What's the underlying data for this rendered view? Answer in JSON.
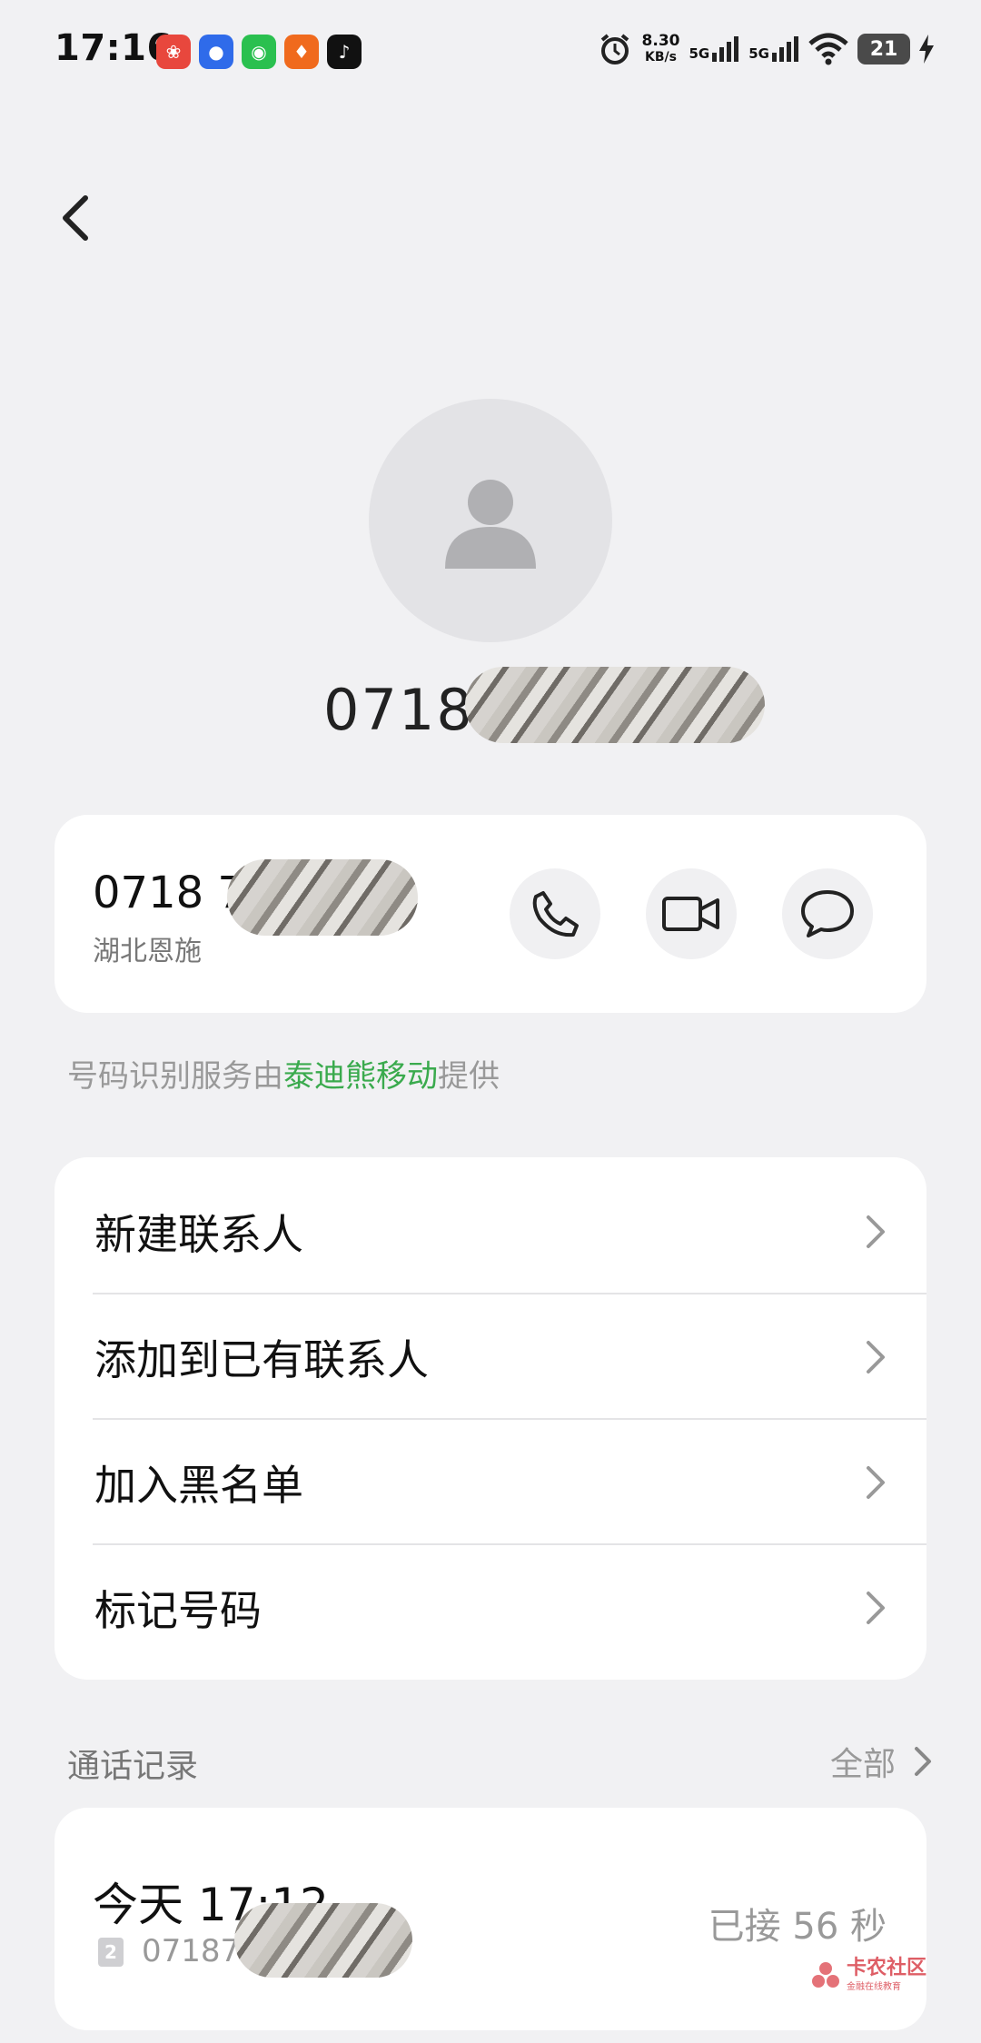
{
  "status_bar": {
    "time": "17:16",
    "net_speed_value": "8.30",
    "net_speed_unit": "KB/s",
    "signal1_label": "5G",
    "signal2_label": "5G",
    "battery_level": "21",
    "apps": [
      "pinduoduo-icon",
      "baidu-icon",
      "wechat-icon",
      "taobao-icon",
      "tiktok-icon"
    ]
  },
  "header": {
    "number_display": "07187"
  },
  "number_card": {
    "number": "0718 7",
    "location": "湖北恩施",
    "actions": [
      "phone-icon",
      "video-call-icon",
      "message-icon"
    ]
  },
  "notice": {
    "prefix": "号码识别服务由",
    "provider": "泰迪熊移动",
    "suffix": "提供"
  },
  "menu": {
    "items": [
      {
        "label": "新建联系人"
      },
      {
        "label": "添加到已有联系人"
      },
      {
        "label": "加入黑名单"
      },
      {
        "label": "标记号码"
      }
    ]
  },
  "call_log": {
    "section_label": "通话记录",
    "all_label": "全部",
    "records": [
      {
        "time": "今天 17:12",
        "sim": "2",
        "number": "071872",
        "status": "已接 56 秒"
      }
    ]
  },
  "watermark": {
    "title": "卡农社区",
    "subtitle": "金融在线教育"
  }
}
